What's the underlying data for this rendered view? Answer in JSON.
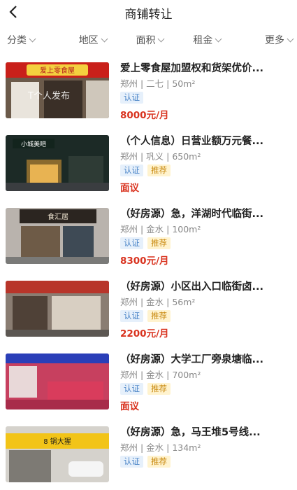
{
  "header": {
    "title": "商铺转让",
    "back_icon": "chevron-left-icon"
  },
  "filters": [
    {
      "label": "分类",
      "icon": "chevron-down-icon"
    },
    {
      "label": "地区",
      "icon": "chevron-down-icon"
    },
    {
      "label": "面积",
      "icon": "chevron-down-icon"
    },
    {
      "label": "租金",
      "icon": "chevron-down-icon"
    },
    {
      "label": "更多",
      "icon": "chevron-down-icon"
    }
  ],
  "listings": [
    {
      "title": "爱上零食屋加盟权和货架优价...",
      "meta": "郑州 | 二七 | 50m²",
      "tags": [
        "认证"
      ],
      "price": "8000元/月",
      "image_sign": "爱上零食屋",
      "image_watermark": "T个人发布"
    },
    {
      "title": "（个人信息）日营业额万元餐...",
      "meta": "郑州 | 巩义 | 650m²",
      "tags": [
        "认证",
        "推荐"
      ],
      "price": "面议",
      "image_sign": "小城美吧"
    },
    {
      "title": "（好房源）急，洋湖时代临街...",
      "meta": "郑州 | 金水 | 100m²",
      "tags": [
        "认证",
        "推荐"
      ],
      "price": "8300元/月",
      "image_sign": "食汇居"
    },
    {
      "title": "（好房源）小区出入口临街卤...",
      "meta": "郑州 | 金水 | 56m²",
      "tags": [
        "认证",
        "推荐"
      ],
      "price": "2200元/月"
    },
    {
      "title": "（好房源）大学工厂旁泉塘临...",
      "meta": "郑州 | 金水 | 700m²",
      "tags": [
        "认证",
        "推荐"
      ],
      "price": "面议"
    },
    {
      "title": "（好房源）急，马王堆5号线...",
      "meta": "郑州 | 金水 | 134m²",
      "tags": [
        "认证",
        "推荐"
      ],
      "price": "",
      "image_sign": "8 锅大猩"
    }
  ],
  "colors": {
    "price": "#d9331f",
    "cert_tag_bg": "#e6f0fb",
    "cert_tag_text": "#4a84c7",
    "rec_tag_bg": "#fff3cf",
    "rec_tag_text": "#c98a10"
  }
}
